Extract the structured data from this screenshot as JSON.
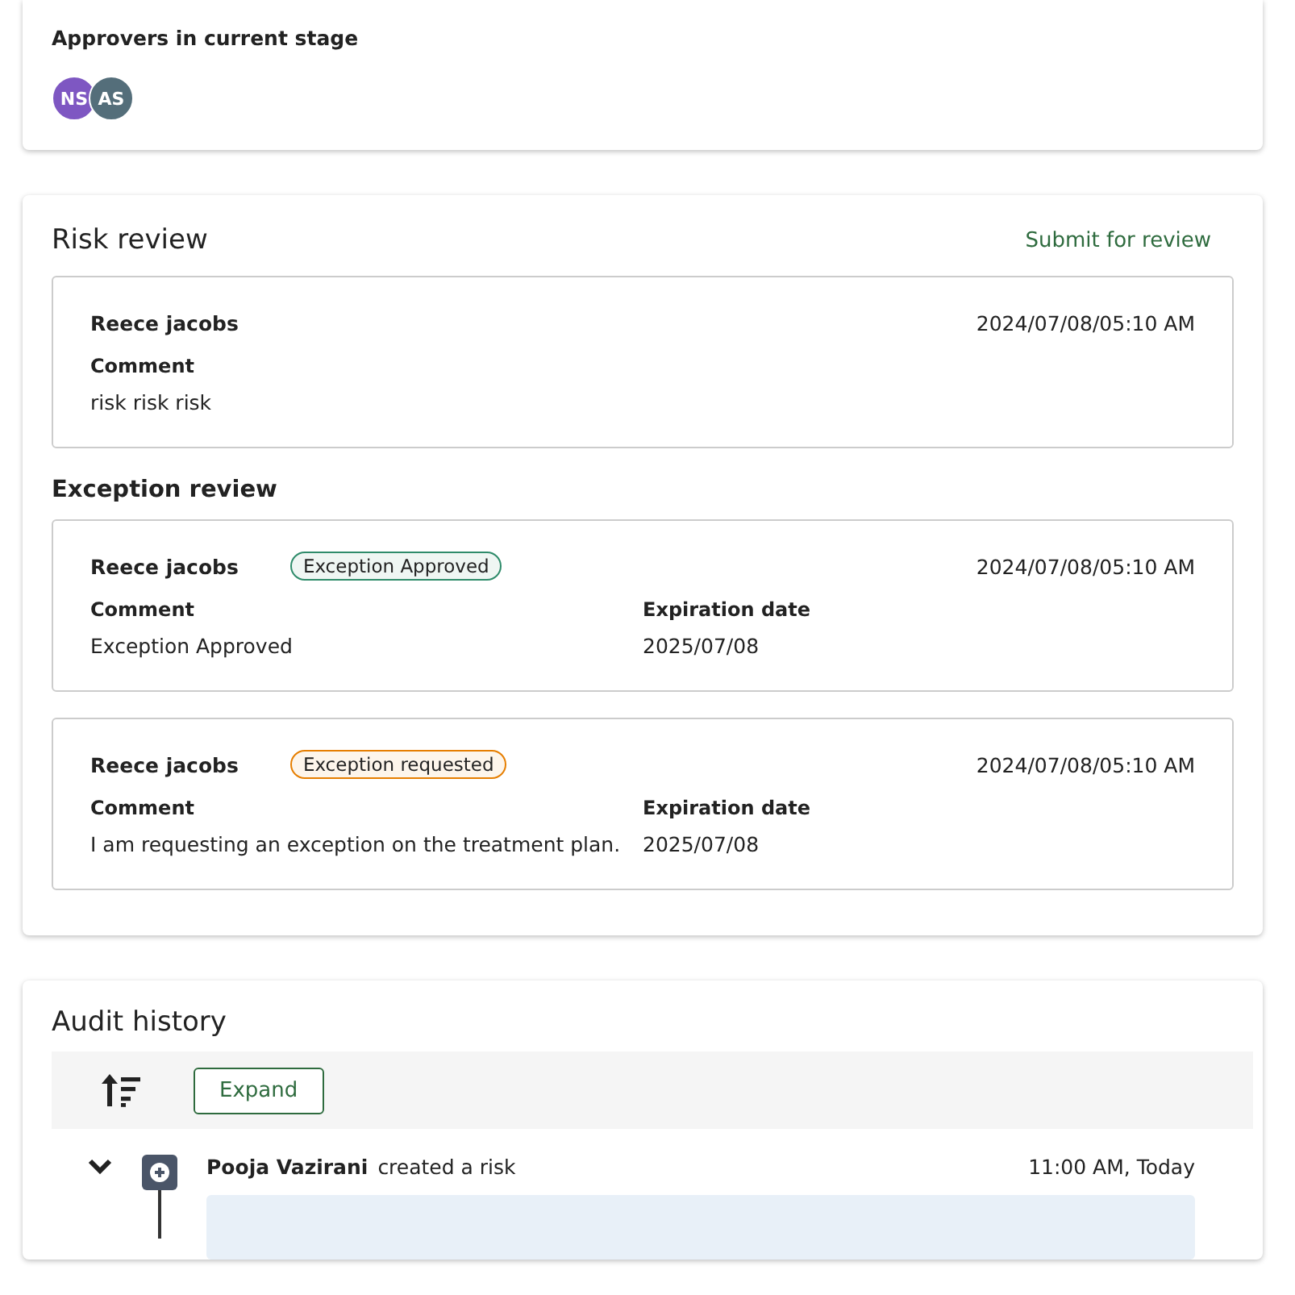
{
  "approvers": {
    "title": "Approvers in current stage",
    "avatars": [
      {
        "initials": "NS",
        "color": "#7e57c2"
      },
      {
        "initials": "AS",
        "color": "#546e7a"
      }
    ]
  },
  "risk_review": {
    "title": "Risk review",
    "submit_link": "Submit for review",
    "entries": [
      {
        "name": "Reece jacobs",
        "date": "2024/07/08/05:10 AM",
        "comment_label": "Comment",
        "comment": "risk risk risk"
      }
    ]
  },
  "exception_review": {
    "title": "Exception review",
    "entries": [
      {
        "name": "Reece jacobs",
        "status": "Exception Approved",
        "color": "#2e8b6a",
        "date": "2024/07/08/05:10 AM",
        "comment_label": "Comment",
        "comment": "Exception Approved",
        "expiration_label": "Expiration date",
        "expiration": "2025/07/08"
      },
      {
        "name": "Reece jacobs",
        "status": "Exception requested",
        "color": "#e67e00",
        "date": "2024/07/08/05:10 AM",
        "comment_label": "Comment",
        "comment": "I am requesting an exception on the treatment plan.",
        "expiration_label": "Expiration date",
        "expiration": "2025/07/08"
      }
    ]
  },
  "audit_history": {
    "title": "Audit history",
    "expand_button": "Expand",
    "events": [
      {
        "user": "Pooja Vazirani",
        "action": "created a risk",
        "time": "11:00 AM, Today",
        "expanded": true
      }
    ]
  }
}
